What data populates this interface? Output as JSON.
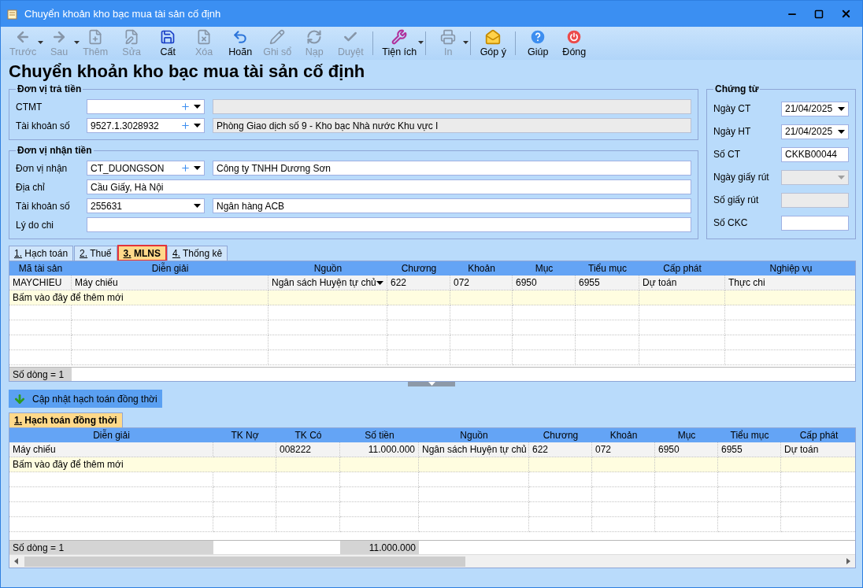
{
  "window": {
    "title": "Chuyển khoản kho bạc mua tài sản cố định"
  },
  "toolbar": [
    {
      "kind": "button",
      "label": "Trước",
      "disabled": true,
      "dropdown": true
    },
    {
      "kind": "button",
      "label": "Sau",
      "disabled": true,
      "dropdown": true
    },
    {
      "kind": "button",
      "label": "Thêm",
      "disabled": true,
      "dropdown": false
    },
    {
      "kind": "button",
      "label": "Sửa",
      "disabled": true,
      "dropdown": false
    },
    {
      "kind": "button",
      "label": "Cất",
      "disabled": false,
      "dropdown": false
    },
    {
      "kind": "button",
      "label": "Xóa",
      "disabled": true,
      "dropdown": false
    },
    {
      "kind": "button",
      "label": "Hoãn",
      "disabled": false,
      "dropdown": false
    },
    {
      "kind": "button",
      "label": "Ghi sổ",
      "disabled": true,
      "dropdown": false
    },
    {
      "kind": "button",
      "label": "Nạp",
      "disabled": true,
      "dropdown": false
    },
    {
      "kind": "button",
      "label": "Duyệt",
      "disabled": true,
      "dropdown": false
    },
    {
      "kind": "separator"
    },
    {
      "kind": "button",
      "label": "Tiện ích",
      "disabled": false,
      "dropdown": true
    },
    {
      "kind": "separator"
    },
    {
      "kind": "button",
      "label": "In",
      "disabled": true,
      "dropdown": true
    },
    {
      "kind": "separator"
    },
    {
      "kind": "button",
      "label": "Góp ý",
      "disabled": false,
      "dropdown": false
    },
    {
      "kind": "separator"
    },
    {
      "kind": "button",
      "label": "Giúp",
      "disabled": false,
      "dropdown": false
    },
    {
      "kind": "button",
      "label": "Đóng",
      "disabled": false,
      "dropdown": false
    }
  ],
  "heading": "Chuyển khoản kho bạc mua tài sản cố định",
  "payer": {
    "title": "Đơn vị trả tiền",
    "rows": [
      {
        "kind": "combo",
        "label": "CTMT",
        "value": "",
        "plus": true,
        "name": "",
        "name_disabled": true
      },
      {
        "kind": "combo",
        "label": "Tài khoản số",
        "value": "9527.1.3028932",
        "plus": true,
        "name": "Phòng Giao dịch số 9 - Kho bạc Nhà nước Khu vực I",
        "name_disabled": true
      }
    ]
  },
  "receiver": {
    "title": "Đơn vị nhận tiền",
    "rows": [
      {
        "kind": "combo",
        "label": "Đơn vị nhận",
        "value": "CT_DUONGSON",
        "plus": true,
        "name": "Công ty TNHH Dương Sơn",
        "name_disabled": false
      },
      {
        "kind": "text",
        "label": "Địa chỉ",
        "value": "Cầu Giấy, Hà Nội"
      },
      {
        "kind": "combo",
        "label": "Tài khoản số",
        "value": "255631",
        "plus": false,
        "name": "Ngân hàng ACB",
        "name_disabled": false
      },
      {
        "kind": "text",
        "label": "Lý do chi",
        "value": ""
      }
    ]
  },
  "voucher": {
    "title": "Chứng từ",
    "rows": [
      {
        "kind": "date",
        "label": "Ngày CT",
        "value": "21/04/2025",
        "disabled": false
      },
      {
        "kind": "date",
        "label": "Ngày HT",
        "value": "21/04/2025",
        "disabled": false
      },
      {
        "kind": "text",
        "label": "Số CT",
        "value": "CKKB00044",
        "disabled": false
      },
      {
        "kind": "date",
        "label": "Ngày giấy rút",
        "value": "",
        "disabled": true
      },
      {
        "kind": "text",
        "label": "Số giấy rút",
        "value": "",
        "disabled": true
      },
      {
        "kind": "text",
        "label": "Số CKC",
        "value": "",
        "disabled": false
      }
    ]
  },
  "grid_tabs": [
    {
      "label": "1. Hạch toán",
      "selected": false
    },
    {
      "label": "2. Thuế",
      "selected": false
    },
    {
      "label": "3. MLNS",
      "selected": true
    },
    {
      "label": "4. Thống kê",
      "selected": false
    }
  ],
  "mlns_table": {
    "columns": [
      {
        "label": "Mã tài sản",
        "kind": "text"
      },
      {
        "label": "Diễn giải",
        "kind": "text"
      },
      {
        "label": "Nguồn",
        "kind": "combo"
      },
      {
        "label": "Chương",
        "kind": "text"
      },
      {
        "label": "Khoản",
        "kind": "text"
      },
      {
        "label": "Mục",
        "kind": "text"
      },
      {
        "label": "Tiểu mục",
        "kind": "text"
      },
      {
        "label": "Cấp phát",
        "kind": "text"
      },
      {
        "label": "Nghiệp vụ",
        "kind": "text"
      }
    ],
    "rows": [
      {
        "active": true,
        "cells": [
          "MAYCHIEU",
          "Máy chiếu",
          "Ngân sách Huyện tự chủ",
          "622",
          "072",
          "6950",
          "6955",
          "Dự toán",
          "Thực chi"
        ]
      }
    ],
    "add_hint": "Bấm vào đây để thêm mới",
    "footer": {
      "count": "Số dòng = 1"
    }
  },
  "update_button": "Cập nhật hạch toán đồng thời",
  "lower_tabs": [
    {
      "label": "1. Hạch toán đồng thời",
      "selected": true
    }
  ],
  "posting_table": {
    "columns": [
      {
        "label": "Diễn giải",
        "kind": "text"
      },
      {
        "label": "TK Nợ",
        "kind": "text"
      },
      {
        "label": "TK Có",
        "kind": "text"
      },
      {
        "label": "Số tiền",
        "kind": "amount"
      },
      {
        "label": "Nguồn",
        "kind": "text"
      },
      {
        "label": "Chương",
        "kind": "text"
      },
      {
        "label": "Khoản",
        "kind": "text"
      },
      {
        "label": "Mục",
        "kind": "text"
      },
      {
        "label": "Tiểu mục",
        "kind": "text"
      },
      {
        "label": "Cấp phát",
        "kind": "text"
      }
    ],
    "rows": [
      {
        "cells": [
          "Máy chiếu",
          "",
          "008222",
          "11.000.000",
          "Ngân sách Huyện tự chủ",
          "622",
          "072",
          "6950",
          "6955",
          "Dự toán"
        ]
      }
    ],
    "add_hint": "Bấm vào đây để thêm mới",
    "footer": {
      "count": "Số dòng = 1",
      "total": "11.000.000"
    }
  }
}
